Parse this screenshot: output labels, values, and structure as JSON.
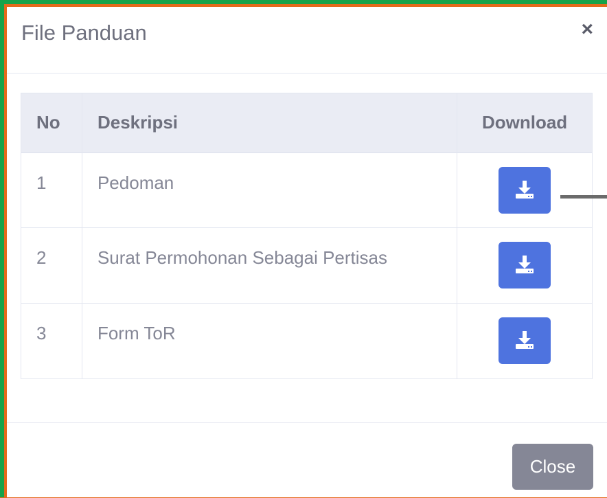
{
  "modal": {
    "title": "File Panduan",
    "close_symbol": "×",
    "footer_close_label": "Close"
  },
  "table": {
    "headers": [
      "No",
      "Deskripsi",
      "Download"
    ],
    "rows": [
      {
        "no": "1",
        "deskripsi": "Pedoman",
        "action_icon": "download-icon"
      },
      {
        "no": "2",
        "deskripsi": "Surat Permohonan Sebagai Pertisas",
        "action_icon": "download-icon"
      },
      {
        "no": "3",
        "deskripsi": "Form ToR",
        "action_icon": "download-icon"
      }
    ]
  },
  "colors": {
    "primary": "#4e73df",
    "secondary": "#858796",
    "frame_highlight": "#16a34a",
    "background_accent": "#e46a1c"
  }
}
